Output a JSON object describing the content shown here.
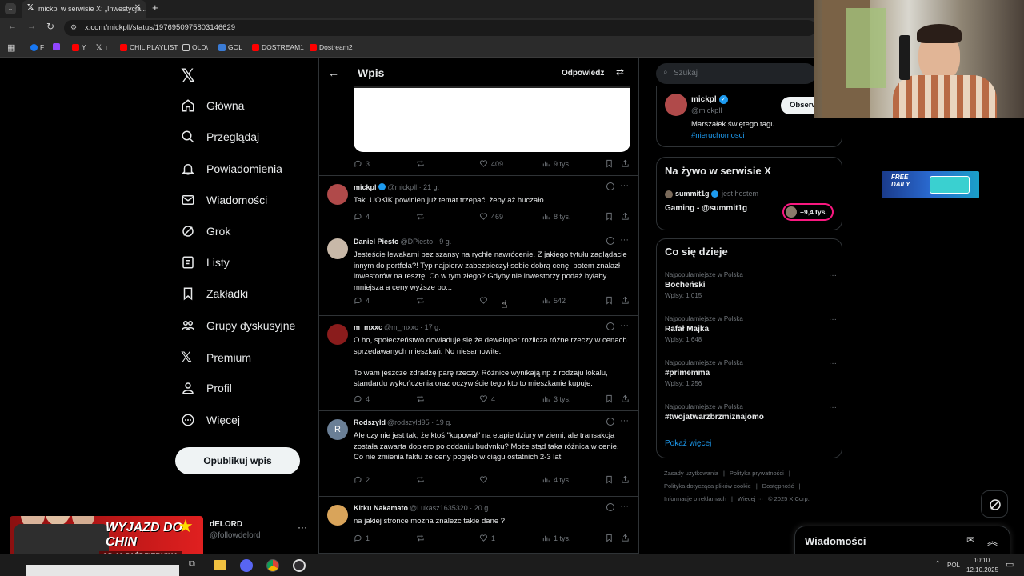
{
  "browser": {
    "tab_title": "mickpl w serwisie X: „Inwestycja...",
    "url": "x.com/mickpll/status/1976950975803146629",
    "bookmarks": [
      "F",
      "Y",
      "T",
      "CHIL PLAYLIST",
      "OLD\\",
      "GOL",
      "DOSTREAM1",
      "Dostream2"
    ]
  },
  "nav": {
    "items": [
      "Główna",
      "Przeglądaj",
      "Powiadomienia",
      "Wiadomości",
      "Grok",
      "Listy",
      "Zakładki",
      "Grupy dyskusyjne",
      "Premium",
      "Profil",
      "Więcej"
    ],
    "publish_label": "Opublikuj wpis",
    "account_name": "dELORD",
    "account_handle": "@followdelord"
  },
  "promo": {
    "headline": "WYJAZD DO CHIN",
    "date": "OD 13 PAŹDZIERNIKA"
  },
  "header": {
    "title": "Wpis",
    "reply_label": "Odpowiedz"
  },
  "main_post_stats": {
    "replies": "3",
    "likes": "409",
    "views": "9 tys."
  },
  "replies": [
    {
      "name": "mickpl",
      "handle": "@mickpll",
      "time": "21 g.",
      "verified": true,
      "text": "Tak. UOKiK powinien już temat trzepać, żeby aż huczało.",
      "replies": "4",
      "retweets": "",
      "likes": "469",
      "views": "8 tys.",
      "avatar_color": "#b04a4a"
    },
    {
      "name": "Daniel Piesto",
      "handle": "@DPiesto",
      "time": "9 g.",
      "verified": false,
      "text": "Jesteście lewakami bez szansy na rychłe nawrócenie. Z jakiego tytułu zaglądacie innym do portfela?! Typ najpierw zabezpieczył sobie dobrą cenę, potem znalazł inwestorów na resztę. Co w tym złego? Gdyby nie inwestorzy podaż byłaby mniejsza a ceny wyższe bo...",
      "replies": "4",
      "retweets": "",
      "likes": "",
      "views": "542",
      "avatar_color": "#c8b8a8"
    },
    {
      "name": "m_mxxc",
      "handle": "@m_mxxc",
      "time": "17 g.",
      "verified": false,
      "text": "O ho, społeczeństwo dowiaduje się że deweloper rozlicza różne rzeczy w cenach sprzedawanych mieszkań. No niesamowite.\n\nTo wam jeszcze zdradzę parę rzeczy. Różnice wynikają np z rodzaju lokalu, standardu wykończenia oraz oczywiście tego kto to mieszkanie kupuje.",
      "replies": "4",
      "retweets": "",
      "likes": "4",
      "views": "3 tys.",
      "avatar_color": "#8a1c1c"
    },
    {
      "name": "Rodszyld",
      "handle": "@rodszyld95",
      "time": "19 g.",
      "verified": false,
      "text": "Ale czy nie jest tak, że ktoś \"kupował\" na etapie dziury w ziemi, ale transakcja została zawarta dopiero po oddaniu budynku? Może stąd taka różnica w cenie.\nCo nie zmienia faktu że ceny pogięło w ciągu ostatnich 2-3 lat",
      "replies": "2",
      "retweets": "",
      "likes": "",
      "views": "4 tys.",
      "avatar_color": "#6a7f96",
      "avatar_letter": "R"
    },
    {
      "name": "Kitku Nakamato",
      "handle": "@Lukasz1635320",
      "time": "20 g.",
      "verified": false,
      "text": "na jakiej stronce mozna znalezc takie dane ?",
      "replies": "1",
      "retweets": "",
      "likes": "1",
      "views": "1 tys.",
      "avatar_color": "#d9a45a"
    }
  ],
  "search": {
    "placeholder": "Szukaj"
  },
  "profile_card": {
    "name": "mickpl",
    "handle": "@mickpll",
    "bio": "Marszałek świętego tagu",
    "hashtag": "#nieruchomosci",
    "follow_label": "Obserwuj"
  },
  "live": {
    "title": "Na żywo w serwisie X",
    "host": "summit1g",
    "host_suffix": "jest hostem",
    "stream_title": "Gaming - @summit1g",
    "viewers": "+9,4 tys."
  },
  "trends": {
    "title": "Co się dzieje",
    "items": [
      {
        "category": "Najpopularniejsze w Polska",
        "name": "Bocheński",
        "count": "Wpisy: 1 015"
      },
      {
        "category": "Najpopularniejsze w Polska",
        "name": "Rafał Majka",
        "count": "Wpisy: 1 648"
      },
      {
        "category": "Najpopularniejsze w Polska",
        "name": "#primemma",
        "count": "Wpisy: 1 256"
      },
      {
        "category": "Najpopularniejsze w Polska",
        "name": "#twojatwarzbrzmiznajomo",
        "count": ""
      }
    ],
    "show_more": "Pokaż więcej"
  },
  "footer": {
    "links": [
      "Zasady użytkowania",
      "Polityka prywatności",
      "Polityka dotycząca plików cookie",
      "Dostępność",
      "Informacje o reklamach",
      "Więcej ···",
      "© 2025 X Corp."
    ]
  },
  "messages_drawer": {
    "title": "Wiadomości"
  },
  "ad": {
    "label": "FREE DAILY"
  },
  "taskbar": {
    "lang": "POL",
    "time": "10:10",
    "date": "12.10.2025"
  },
  "colors": {
    "accent": "#1d9bf0",
    "border": "#2f3336",
    "muted": "#71767b"
  }
}
